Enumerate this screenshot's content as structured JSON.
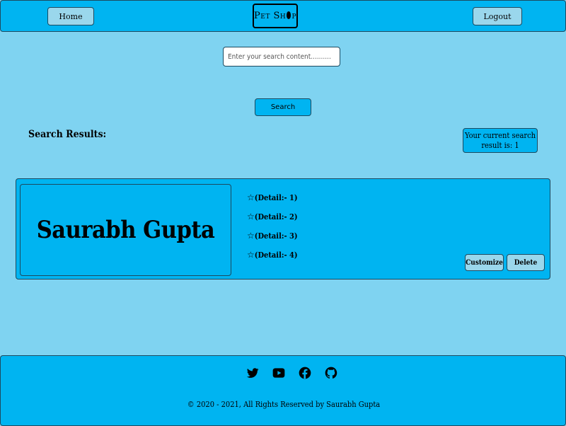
{
  "header": {
    "home_label": "Home",
    "logo_text_left": "Pet Sh",
    "logo_text_right": "p",
    "logout_label": "Logout"
  },
  "search": {
    "placeholder": "Enter your search content..........",
    "button_label": "Search"
  },
  "results": {
    "label": "Search Results:",
    "count_text": "Your current search result is: 1"
  },
  "card": {
    "name": "Saurabh Gupta",
    "details": [
      "(Detail:- 1)",
      "(Detail:- 2)",
      "(Detail:- 3)",
      "(Detail:- 4)"
    ],
    "star_icon": "☆",
    "customize_label": "Customize",
    "delete_label": "Delete"
  },
  "footer": {
    "icons": [
      "twitter-icon",
      "youtube-icon",
      "facebook-icon",
      "github-icon"
    ],
    "copyright": "© 2020 - 2021, All Rights Reserved by Saurabh Gupta"
  },
  "colors": {
    "page_bg": "#7fd3f1",
    "accent": "#00b4f1",
    "button_light": "#9ad7ec"
  }
}
